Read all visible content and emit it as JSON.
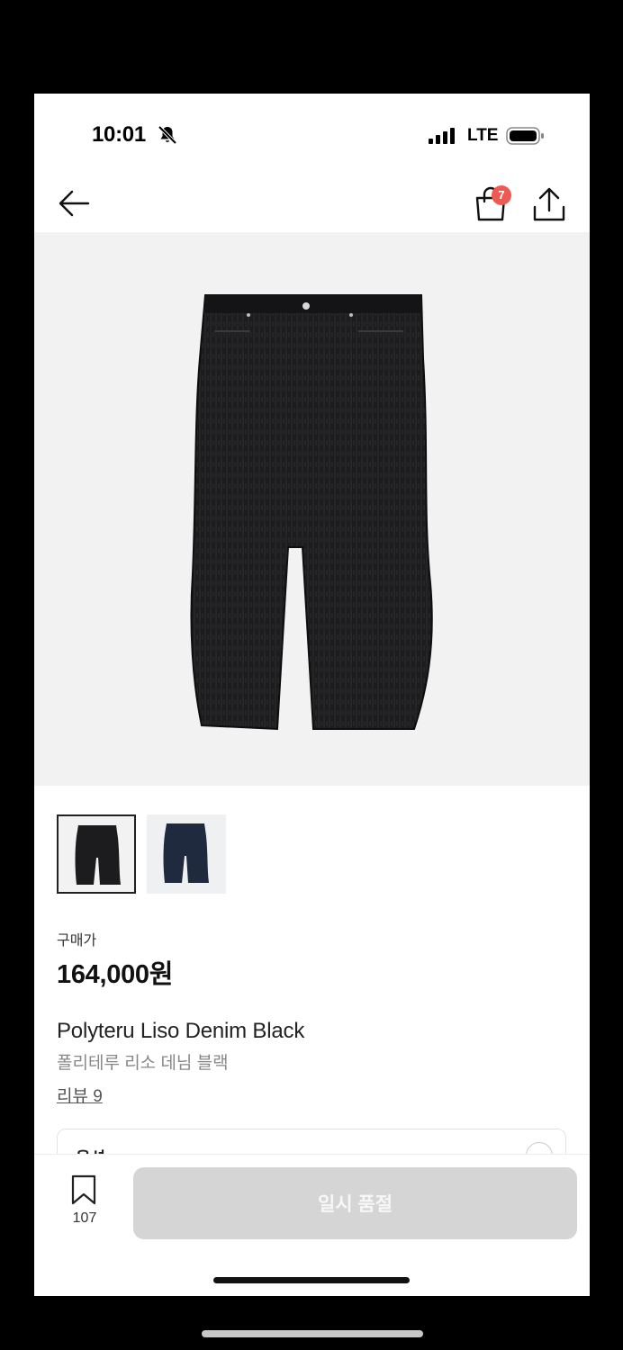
{
  "status_bar": {
    "time": "10:01",
    "network": "LTE",
    "icons": [
      "bell-slash-icon",
      "signal-icon",
      "battery-icon"
    ]
  },
  "nav": {
    "back_icon": "arrow-left-icon",
    "cart_icon": "shopping-bag-icon",
    "cart_count": "7",
    "share_icon": "share-icon"
  },
  "product": {
    "price_label": "구매가",
    "price": "164,000원",
    "name_en": "Polyteru Liso Denim Black",
    "name_ko": "폴리테루 리소 데님 블랙",
    "review_link": "리뷰 9",
    "thumbnails": [
      "black",
      "navy"
    ],
    "selected_thumbnail": 0
  },
  "option": {
    "label": "옵션"
  },
  "bottom_bar": {
    "wishlist_icon": "bookmark-icon",
    "wishlist_count": "107",
    "soldout_label": "일시 품절"
  },
  "colors": {
    "badge": "#ee5a52",
    "disabled_button": "#d5d5d5",
    "image_bg": "#f2f2f2"
  }
}
